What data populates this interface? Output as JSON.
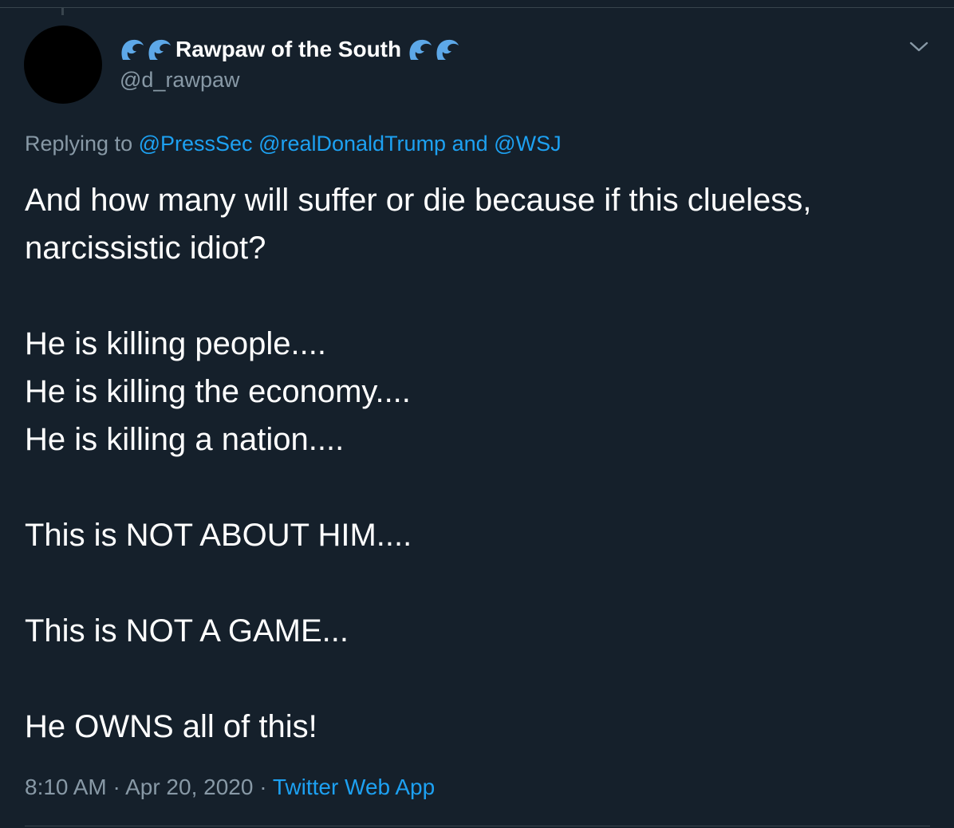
{
  "tweet": {
    "display_name": "Rawpaw of the South",
    "name_emoji": "water-wave-emoji",
    "handle": "@d_rawpaw",
    "reply": {
      "prefix": "Replying to",
      "mention_1": "@PressSec",
      "mention_2": "@realDonaldTrump",
      "and": "and",
      "mention_3": "@WSJ"
    },
    "text": {
      "line_1": "And how many will suffer or die because if this clueless,",
      "line_2": "narcissistic idiot?",
      "line_3": "He is killing people....",
      "line_4": "He is killing the economy....",
      "line_5": "He is killing a nation....",
      "line_6": "This is NOT ABOUT HIM....",
      "line_7": "This is NOT A GAME...",
      "line_8": "He OWNS all of this!"
    },
    "time": "8:10 AM",
    "separator": "·",
    "date": "Apr 20, 2020",
    "source_app": "Twitter Web App"
  },
  "colors": {
    "background": "#15202b",
    "primary_text": "#ffffff",
    "secondary_text": "#8899a6",
    "link": "#1da1f2",
    "border": "#38444d",
    "wave_emoji": "#5da8e8"
  },
  "icons": {
    "more_menu": "chevron-down-icon"
  }
}
